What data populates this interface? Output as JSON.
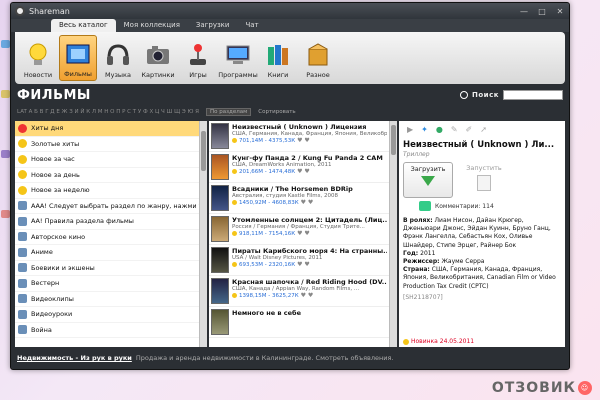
{
  "window": {
    "title": "Shareman"
  },
  "tabs": [
    "Весь каталог",
    "Моя коллекция",
    "Загрузки",
    "Чат"
  ],
  "toolbar": [
    {
      "label": "Новости",
      "icon": "bulb-icon"
    },
    {
      "label": "Фильмы",
      "icon": "film-icon"
    },
    {
      "label": "Музыка",
      "icon": "headphones-icon"
    },
    {
      "label": "Картинки",
      "icon": "camera-icon"
    },
    {
      "label": "Игры",
      "icon": "joystick-icon"
    },
    {
      "label": "Программы",
      "icon": "computer-icon"
    },
    {
      "label": "Книги",
      "icon": "books-icon"
    },
    {
      "label": "Разное",
      "icon": "box-icon"
    }
  ],
  "section": {
    "title": "Фильмы",
    "search_label": "Поиск",
    "search_value": ""
  },
  "alphabet": "LAT  А Б В Г Д Е Ж З И Й К Л М Н О П Р С Т У Ф Х Ц Ч Ш Щ Э Ю Я",
  "alpha_buttons": {
    "by_section": "По разделам",
    "sort": "Сортировать"
  },
  "categories": [
    "Хиты дня",
    "Золотые хиты",
    "Новое за час",
    "Новое за день",
    "Новое за неделю",
    "ААА! Следует выбрать раздел по жанру, нажми тут",
    "АА! Правила раздела фильмы",
    "Авторское кино",
    "Аниме",
    "Боевики и экшены",
    "Вестерн",
    "Видеоклипы",
    "Видеоуроки",
    "Война"
  ],
  "films": [
    {
      "title": "Неизвестный ( Unknown ) Лицензия",
      "meta": "США, Германия, Канада, Франция, Япония, Великобрита...",
      "stats": "701,14М - 4375,53К"
    },
    {
      "title": "Кунг-фу Панда 2 / Kung Fu Panda 2 CAM",
      "meta": "США, DreamWorks Animation, 2011",
      "stats": "201,66М - 1474,48К"
    },
    {
      "title": "Всадники / The Horsemen BDRip",
      "meta": "Австралия, студия Kastle Films, 2008",
      "stats": "1450,92М - 4608,83К"
    },
    {
      "title": "Утомленные солнцем 2: Цитадель (Лиц...",
      "meta": "Россия / Германия / Франция, Студия Трите...",
      "stats": "918,11М - 7154,16К"
    },
    {
      "title": "Пираты Карибского моря 4: На странны...",
      "meta": "USA / Walt Disney Pictures, 2011",
      "stats": "693,53М - 2320,16К"
    },
    {
      "title": "Красная шапочка / Red Riding Hood (DV...",
      "meta": "США, Канада / Appian Way, Random Films, ...",
      "stats": "1398,15М - 3625,27К"
    },
    {
      "title": "Немного не в себе",
      "meta": "",
      "stats": ""
    }
  ],
  "detail": {
    "title": "Неизвестный ( Unknown ) Ли...",
    "genre": "Триллер",
    "download_label": "Загрузить",
    "run_label": "Запустить",
    "comments": "Комментарии: 114",
    "roles_label": "В ролях:",
    "roles": "Лиам Нисон, Дайан Крюгер, Дженьюари Джонс, Эйдан Куинн, Бруно Ганц, Фрэнк Лангелла, Себастьян Кох, Оливье Шнайдер, Стипе Эрцег, Райнер Бок",
    "year_label": "Год:",
    "year": "2011",
    "director_label": "Режиссер:",
    "director": "Жауме Серра",
    "country_label": "Страна:",
    "country": "США, Германия, Канада, Франция, Япония, Великобритания, Canadian Film or Video Production Tax Credit (CPTC)",
    "id": "[SH2118707]",
    "new_badge": "Новинка 24.05.2011"
  },
  "footer": {
    "link": "Недвижимость - Из рук в руки",
    "text": "Продажа и аренда недвижимости в Калининграде. Смотреть объявления."
  },
  "watermark": "ОТЗОВИК"
}
